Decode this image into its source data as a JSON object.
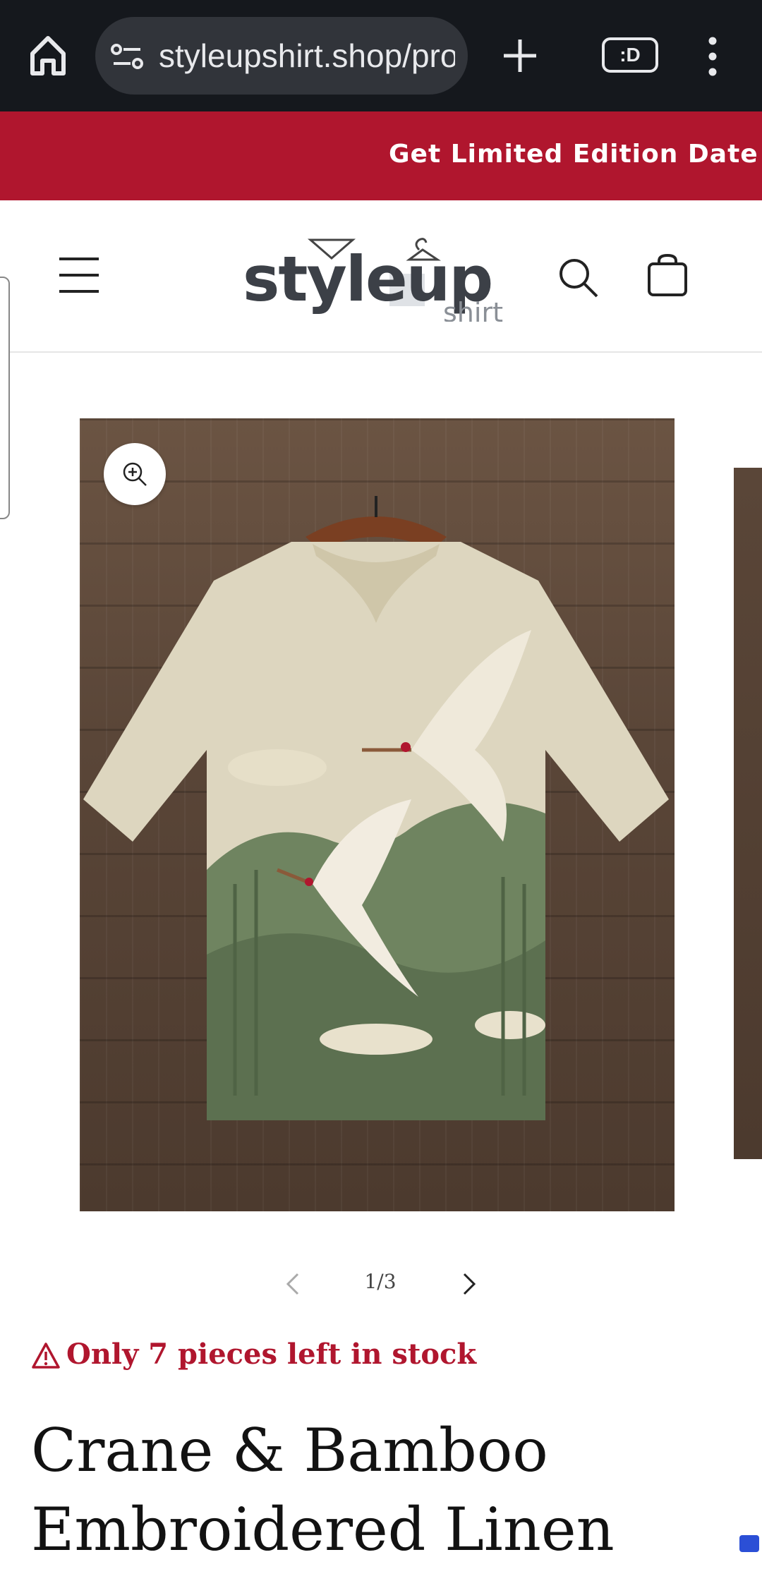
{
  "browser": {
    "url": "styleupshirt.shop/pro",
    "tab_switcher_label": ":D"
  },
  "announcement": {
    "text": "Get Limited Edition Date Nig"
  },
  "header": {
    "logo_main": "styleup",
    "logo_sub": "shirt"
  },
  "gallery": {
    "counter": "1/3"
  },
  "stock": {
    "text": "Only 7 pieces left in stock"
  },
  "product": {
    "title": "Crane & Bamboo Embroidered Linen"
  },
  "colors": {
    "accent": "#b0162e",
    "browser_bg": "#15181d",
    "url_pill": "#31343a"
  }
}
